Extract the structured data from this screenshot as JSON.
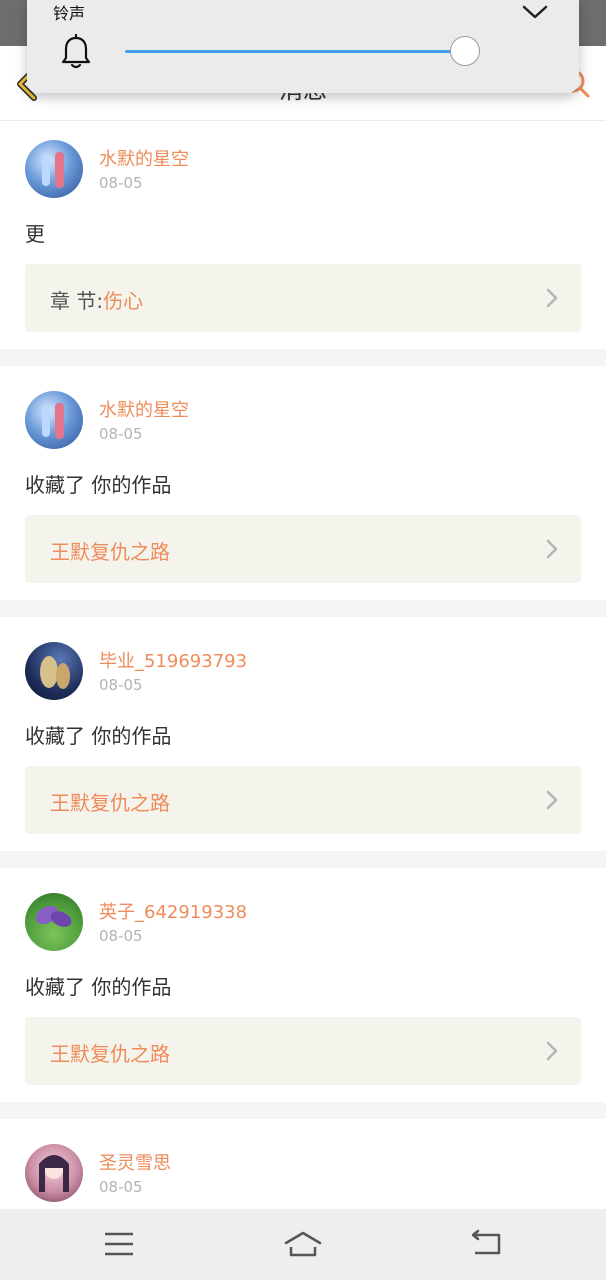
{
  "header": {
    "title": "消息"
  },
  "volume": {
    "label": "铃声",
    "level": 0.96
  },
  "messages": [
    {
      "user": "水默的星空",
      "date": "08-05",
      "text": "更",
      "ref_prefix": "章 节:",
      "ref_title": "伤心"
    },
    {
      "user": "水默的星空",
      "date": "08-05",
      "text": "收藏了 你的作品",
      "ref_prefix": "",
      "ref_title": "王默复仇之路"
    },
    {
      "user": "毕业_519693793",
      "date": "08-05",
      "text": "收藏了 你的作品",
      "ref_prefix": "",
      "ref_title": "王默复仇之路"
    },
    {
      "user": "英子_642919338",
      "date": "08-05",
      "text": "收藏了 你的作品",
      "ref_prefix": "",
      "ref_title": "王默复仇之路"
    },
    {
      "user": "圣灵雪思",
      "date": "08-05"
    }
  ],
  "colors": {
    "accent": "#ef8c5b",
    "slider": "#3ea0ee",
    "ref_bg": "#f4f3ec"
  }
}
